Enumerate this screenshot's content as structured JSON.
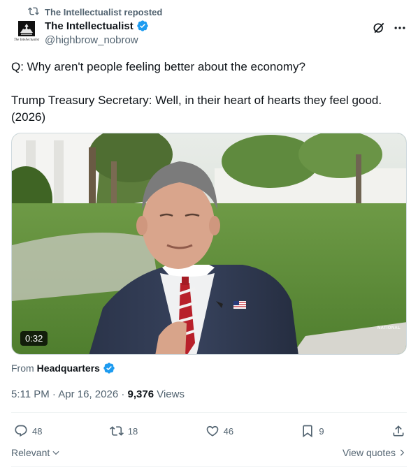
{
  "repost": {
    "text": "The Intellectualist reposted",
    "icon": "repost-icon"
  },
  "author": {
    "display_name": "The Intellectualist",
    "handle": "@highbrow_nobrow",
    "avatar_caption": "The Intellectualist",
    "verified_color": "#1d9bf0"
  },
  "header_icons": [
    "grok-icon",
    "more-icon"
  ],
  "tweet": {
    "line1": "Q: Why aren't people feeling better about the economy?",
    "line2": "Trump Treasury Secretary: Well, in their heart of hearts they feel good.",
    "line3": "(2026)"
  },
  "media": {
    "duration": "0:32",
    "watermark": "NATIONAL"
  },
  "source": {
    "prefix": "From",
    "name": "Headquarters"
  },
  "meta": {
    "time": "5:11 PM",
    "sep1": "·",
    "date": "Apr 16, 2026",
    "sep2": "·",
    "views_count": "9,376",
    "views_label": "Views"
  },
  "actions": {
    "replies": "48",
    "reposts": "18",
    "likes": "46",
    "bookmarks": "9"
  },
  "footer": {
    "sort_label": "Relevant",
    "quotes_label": "View quotes"
  },
  "colors": {
    "text": "#0f1419",
    "muted": "#536471",
    "accent": "#1d9bf0"
  }
}
